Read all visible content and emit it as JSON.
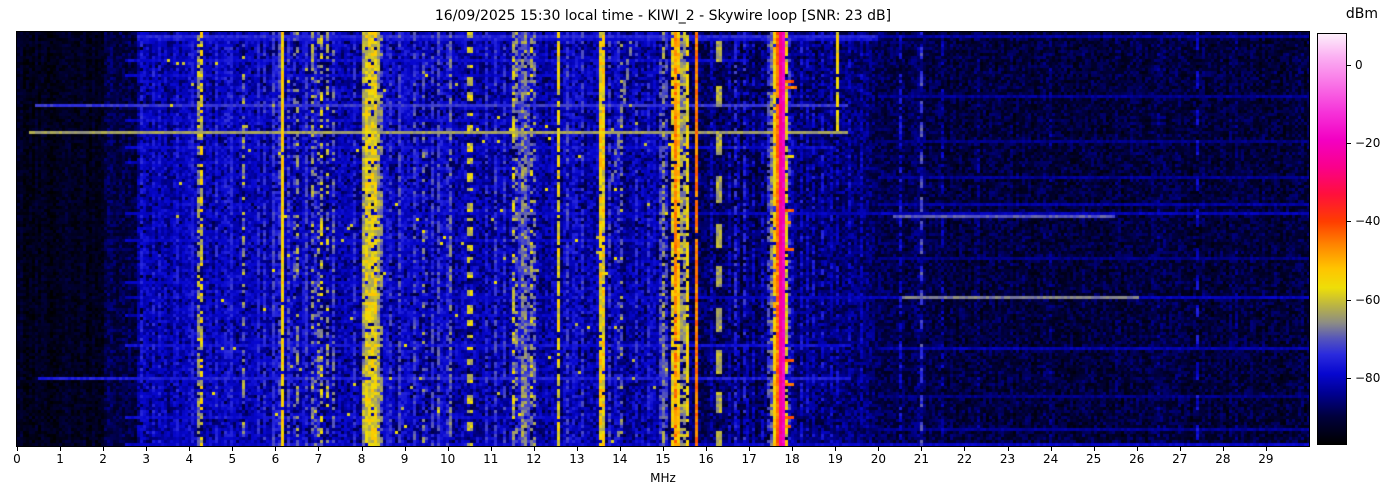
{
  "title": "16/09/2025 15:30 local time - KIWI_2 - Skywire loop [SNR: 23 dB]",
  "header": {
    "timestamp_local": "16/09/2025 15:30",
    "receiver": "KIWI_2",
    "antenna": "Skywire loop",
    "snr_db": 23
  },
  "xaxis": {
    "label": "MHz",
    "min": 0,
    "max": 30,
    "tick_values": [
      0,
      1,
      2,
      3,
      4,
      5,
      6,
      7,
      8,
      9,
      10,
      11,
      12,
      13,
      14,
      15,
      16,
      17,
      18,
      19,
      20,
      21,
      22,
      23,
      24,
      25,
      26,
      27,
      28,
      29
    ]
  },
  "colorbar": {
    "label": "dBm",
    "vmin": -97,
    "vmax": 8,
    "tick_values": [
      0,
      -20,
      -40,
      -60,
      -80
    ],
    "tick_labels": [
      "0",
      "−20",
      "−40",
      "−60",
      "−80"
    ],
    "stops": [
      [
        -97,
        "#000000"
      ],
      [
        -90,
        "#00003c"
      ],
      [
        -84,
        "#000092"
      ],
      [
        -79,
        "#0707cf"
      ],
      [
        -74,
        "#2b2bdd"
      ],
      [
        -70,
        "#5555bb"
      ],
      [
        -66,
        "#8c8c85"
      ],
      [
        -62,
        "#b5b04a"
      ],
      [
        -57,
        "#eede08"
      ],
      [
        -52,
        "#ffc400"
      ],
      [
        -46,
        "#ff8500"
      ],
      [
        -40,
        "#ff3d00"
      ],
      [
        -33,
        "#ff0f3c"
      ],
      [
        -26,
        "#fa008c"
      ],
      [
        -19,
        "#f300c3"
      ],
      [
        -12,
        "#f633d9"
      ],
      [
        -4,
        "#f97ae8"
      ],
      [
        2,
        "#fbaef2"
      ],
      [
        8,
        "#fdeffb"
      ]
    ]
  },
  "chart_data": {
    "type": "heatmap",
    "title": "16/09/2025 15:30 local time - KIWI_2 - Skywire loop [SNR: 23 dB]",
    "xlabel": "MHz",
    "x_range_mhz": [
      0,
      30
    ],
    "value_unit": "dBm",
    "value_range_dbm": [
      -97,
      8
    ],
    "legend_position": "right-colorbar",
    "grid": false,
    "noise_profile": [
      [
        0.0,
        2.0,
        -94,
        3.0
      ],
      [
        2.0,
        2.9,
        -90,
        4.0
      ],
      [
        2.9,
        15.0,
        -85,
        6.0
      ],
      [
        15.0,
        16.2,
        -88,
        5.0
      ],
      [
        16.2,
        17.45,
        -89,
        5.0
      ],
      [
        17.45,
        19.9,
        -87,
        5.0
      ],
      [
        19.9,
        21.5,
        -90,
        4.5
      ],
      [
        21.5,
        30.0,
        -91,
        4.5
      ]
    ],
    "signals_format": "[freq_MHz, halfwidth_MHz, level_dBm, on_probability, jitter_dB]",
    "signals": {
      "major": [
        [
          4.27,
          0.025,
          -59,
          0.7,
          7
        ],
        [
          5.25,
          0.02,
          -66,
          0.55,
          7
        ],
        [
          6.17,
          0.022,
          -55,
          0.95,
          4
        ],
        [
          6.5,
          0.03,
          -68,
          0.55,
          8
        ],
        [
          6.88,
          0.02,
          -67,
          0.5,
          8
        ],
        [
          7.05,
          0.045,
          -63,
          0.5,
          8
        ],
        [
          7.2,
          0.03,
          -65,
          0.5,
          8
        ],
        [
          8.2,
          0.18,
          -58,
          0.92,
          6
        ],
        [
          9.45,
          0.03,
          -70,
          0.45,
          8
        ],
        [
          11.55,
          0.025,
          -63,
          0.6,
          8
        ],
        [
          11.78,
          0.09,
          -67,
          0.85,
          6
        ],
        [
          11.95,
          0.04,
          -64,
          0.55,
          8
        ],
        [
          12.57,
          0.02,
          -57,
          0.85,
          5
        ],
        [
          13.57,
          0.025,
          -50,
          0.93,
          7
        ],
        [
          15.0,
          0.05,
          -67,
          0.75,
          6
        ],
        [
          15.2,
          0.018,
          -57,
          0.8,
          5
        ],
        [
          15.3,
          0.018,
          -47,
          0.95,
          5
        ],
        [
          15.45,
          0.014,
          -58,
          0.75,
          5
        ],
        [
          15.55,
          0.014,
          -56,
          0.8,
          5
        ],
        [
          15.78,
          0.02,
          -45,
          0.97,
          4
        ],
        [
          17.52,
          0.06,
          -67,
          0.8,
          6
        ],
        [
          17.62,
          0.014,
          -48,
          0.9,
          5
        ],
        [
          17.68,
          0.012,
          -38,
          0.95,
          4
        ],
        [
          17.755,
          0.012,
          -19,
          1.0,
          3
        ],
        [
          17.82,
          0.02,
          -51,
          0.8,
          6
        ]
      ],
      "blue": [
        [
          2.87,
          0.02,
          -77,
          0.85,
          4
        ],
        [
          3.2,
          0.02,
          -77,
          0.8,
          4
        ],
        [
          3.33,
          0.015,
          -78,
          0.8,
          4
        ],
        [
          3.9,
          0.04,
          -75,
          0.85,
          4
        ],
        [
          4.05,
          0.02,
          -77,
          0.8,
          4
        ],
        [
          4.65,
          0.015,
          -76,
          0.8,
          4
        ],
        [
          4.85,
          0.015,
          -77,
          0.75,
          4
        ],
        [
          5.0,
          0.02,
          -76,
          0.8,
          4
        ],
        [
          5.5,
          0.02,
          -75,
          0.8,
          4
        ],
        [
          5.62,
          0.015,
          -76,
          0.75,
          4
        ],
        [
          5.75,
          0.015,
          -75,
          0.75,
          4
        ],
        [
          5.95,
          0.03,
          -73,
          0.85,
          4
        ],
        [
          6.07,
          0.015,
          -72,
          0.8,
          4
        ],
        [
          6.3,
          0.02,
          -72,
          0.75,
          4
        ],
        [
          6.7,
          0.02,
          -73,
          0.75,
          4
        ],
        [
          7.35,
          0.02,
          -70,
          0.7,
          5
        ],
        [
          7.8,
          0.02,
          -75,
          0.7,
          4
        ],
        [
          8.45,
          0.03,
          -68,
          0.7,
          6
        ],
        [
          8.65,
          0.02,
          -74,
          0.7,
          4
        ],
        [
          8.9,
          0.03,
          -72,
          0.8,
          4
        ],
        [
          9.05,
          0.02,
          -73,
          0.8,
          4
        ],
        [
          9.25,
          0.02,
          -72,
          0.7,
          4
        ],
        [
          9.65,
          0.02,
          -73,
          0.7,
          4
        ],
        [
          9.8,
          0.02,
          -72,
          0.7,
          4
        ],
        [
          10.05,
          0.03,
          -69,
          0.7,
          5
        ],
        [
          10.9,
          0.02,
          -75,
          0.7,
          4
        ],
        [
          11.1,
          0.02,
          -73,
          0.7,
          4
        ],
        [
          11.3,
          0.02,
          -74,
          0.7,
          4
        ],
        [
          12.75,
          0.02,
          -73,
          0.7,
          4
        ],
        [
          12.95,
          0.02,
          -72,
          0.7,
          4
        ],
        [
          13.1,
          0.02,
          -74,
          0.6,
          4
        ],
        [
          13.75,
          0.02,
          -73,
          0.6,
          4
        ],
        [
          14.0,
          0.05,
          -68,
          0.4,
          8
        ],
        [
          14.35,
          0.02,
          -75,
          0.6,
          4
        ],
        [
          14.65,
          0.02,
          -76,
          0.6,
          4
        ],
        [
          16.7,
          0.015,
          -75,
          0.7,
          4
        ],
        [
          16.9,
          0.015,
          -76,
          0.6,
          4
        ],
        [
          17.95,
          0.03,
          -74,
          0.5,
          5
        ],
        [
          18.2,
          0.015,
          -78,
          0.6,
          4
        ],
        [
          18.5,
          0.012,
          -79,
          0.5,
          4
        ],
        [
          18.7,
          0.012,
          -78,
          0.5,
          4
        ],
        [
          19.3,
          0.012,
          -80,
          0.5,
          4
        ],
        [
          19.6,
          0.01,
          -81,
          0.5,
          4
        ],
        [
          20.5,
          0.012,
          -79,
          0.6,
          4
        ],
        [
          20.95,
          0.012,
          -79,
          0.5,
          4
        ],
        [
          21.45,
          0.01,
          -82,
          0.5,
          4
        ],
        [
          22.3,
          0.008,
          -85,
          0.4,
          4
        ],
        [
          24.0,
          0.008,
          -85,
          0.3,
          4
        ],
        [
          26.5,
          0.008,
          -86,
          0.3,
          4
        ],
        [
          28.3,
          0.008,
          -86,
          0.3,
          4
        ]
      ],
      "minor_f": [
        2.95,
        3.05,
        3.45,
        3.55,
        3.65,
        3.75,
        4.15,
        4.4,
        4.47,
        4.75,
        5.1,
        5.35,
        5.85,
        6.62,
        6.95,
        7.5,
        7.6,
        7.7,
        8.55,
        8.75,
        9.15,
        9.9,
        10.2,
        10.35,
        10.7,
        11.2,
        11.42,
        11.65,
        12.1,
        12.3,
        12.45,
        13.3,
        13.45,
        13.9,
        14.2,
        14.5,
        14.8,
        16.1,
        16.5,
        17.1,
        17.3,
        18.35,
        18.9
      ],
      "minor_style": [
        0.012,
        -80,
        0.6,
        4
      ],
      "timed_format": "[freq_MHz, halfwidth_MHz, level_dBm, on_probability, jitter_dB, t0_frac, t1_frac]",
      "timed": [
        [
          19.02,
          0.015,
          -57,
          0.95,
          4,
          0.0,
          0.24
        ],
        [
          19.02,
          0.015,
          -80,
          0.6,
          4,
          0.24,
          1.0
        ]
      ],
      "dashed_format": "[freq_MHz, halfwidth_MHz, level_dBm, jitter_dB, on_rows, off_rows]",
      "dashed": [
        [
          10.5,
          0.015,
          -60,
          5,
          2,
          3
        ],
        [
          16.3,
          0.02,
          -63,
          4,
          8,
          7
        ],
        [
          21.0,
          0.012,
          -72,
          4,
          4,
          4
        ],
        [
          27.4,
          0.012,
          -79,
          4,
          5,
          6
        ]
      ]
    },
    "events_format": "[t_frac, f0_MHz, f1_MHz, level_dBm]",
    "events": [
      [
        0.004,
        2.8,
        20,
        -75
      ],
      [
        0.004,
        20,
        30,
        -83
      ],
      [
        0.012,
        2.8,
        20,
        -78
      ],
      [
        0.068,
        2.5,
        17,
        -79
      ],
      [
        0.105,
        2.5,
        13,
        -80
      ],
      [
        0.15,
        20,
        30,
        -84
      ],
      [
        0.176,
        0.4,
        19.3,
        -73
      ],
      [
        0.21,
        2.5,
        12,
        -80
      ],
      [
        0.237,
        0.3,
        19.3,
        -64
      ],
      [
        0.26,
        20,
        30,
        -85
      ],
      [
        0.278,
        2.5,
        19,
        -79
      ],
      [
        0.31,
        2.5,
        10,
        -81
      ],
      [
        0.35,
        20,
        30,
        -84
      ],
      [
        0.41,
        20,
        30,
        -83
      ],
      [
        0.437,
        2.5,
        30,
        -81
      ],
      [
        0.44,
        20.3,
        25.5,
        -70
      ],
      [
        0.5,
        2.5,
        15,
        -80
      ],
      [
        0.54,
        20,
        30,
        -85
      ],
      [
        0.6,
        2.5,
        10,
        -80
      ],
      [
        0.635,
        2.5,
        30,
        -81
      ],
      [
        0.635,
        20.5,
        26,
        -67
      ],
      [
        0.68,
        2.5,
        13,
        -81
      ],
      [
        0.755,
        2.5,
        19.3,
        -78
      ],
      [
        0.76,
        20,
        30,
        -82
      ],
      [
        0.83,
        0.5,
        19.3,
        -76
      ],
      [
        0.875,
        20,
        30,
        -85
      ],
      [
        0.925,
        2.5,
        13,
        -79
      ],
      [
        0.96,
        20,
        30,
        -84
      ],
      [
        0.99,
        2.5,
        30,
        -80
      ]
    ],
    "blips_format": "[t_frac, f0_MHz, f1_MHz, level_dBm]",
    "blips": [
      [
        0.115,
        17.78,
        18.02,
        -42
      ],
      [
        0.128,
        17.78,
        18.1,
        -46
      ],
      [
        0.3,
        17.9,
        18.05,
        -58
      ],
      [
        0.425,
        17.78,
        18.0,
        -42
      ],
      [
        0.455,
        17.78,
        17.95,
        -48
      ],
      [
        0.52,
        17.78,
        18.0,
        -45
      ],
      [
        0.79,
        17.78,
        18.05,
        -40
      ],
      [
        0.845,
        17.78,
        18.0,
        -44
      ],
      [
        0.925,
        17.75,
        18.05,
        -40
      ],
      [
        0.95,
        17.78,
        17.98,
        -46
      ]
    ],
    "drift": {
      "t0": 0.02,
      "t1": 0.36,
      "f0": 14.25,
      "f1": 13.82,
      "lvl": -67,
      "p": 0.85
    }
  }
}
